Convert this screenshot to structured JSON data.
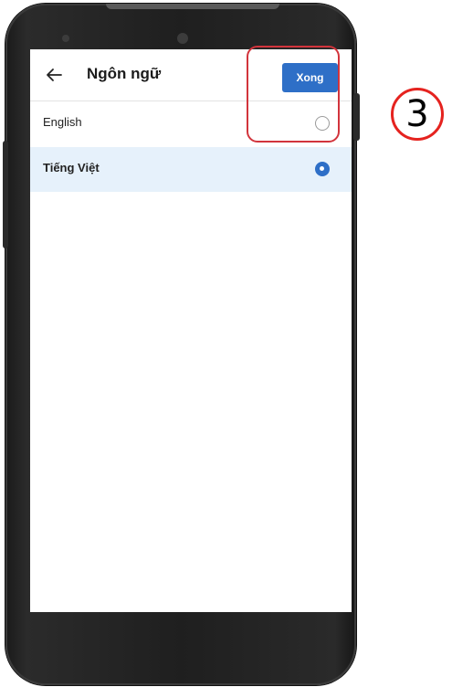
{
  "app_bar": {
    "title": "Ngôn ngữ",
    "done_label": "Xong",
    "back_icon": "arrow-left-icon"
  },
  "languages": [
    {
      "label": "English",
      "selected": false
    },
    {
      "label": "Tiếng Việt",
      "selected": true
    }
  ],
  "annotation": {
    "step_number": "3",
    "marker_color": "#e5231f",
    "box_color": "#d2343c"
  },
  "colors": {
    "accent": "#2e6fc7",
    "selected_row_bg": "#e6f1fb"
  }
}
